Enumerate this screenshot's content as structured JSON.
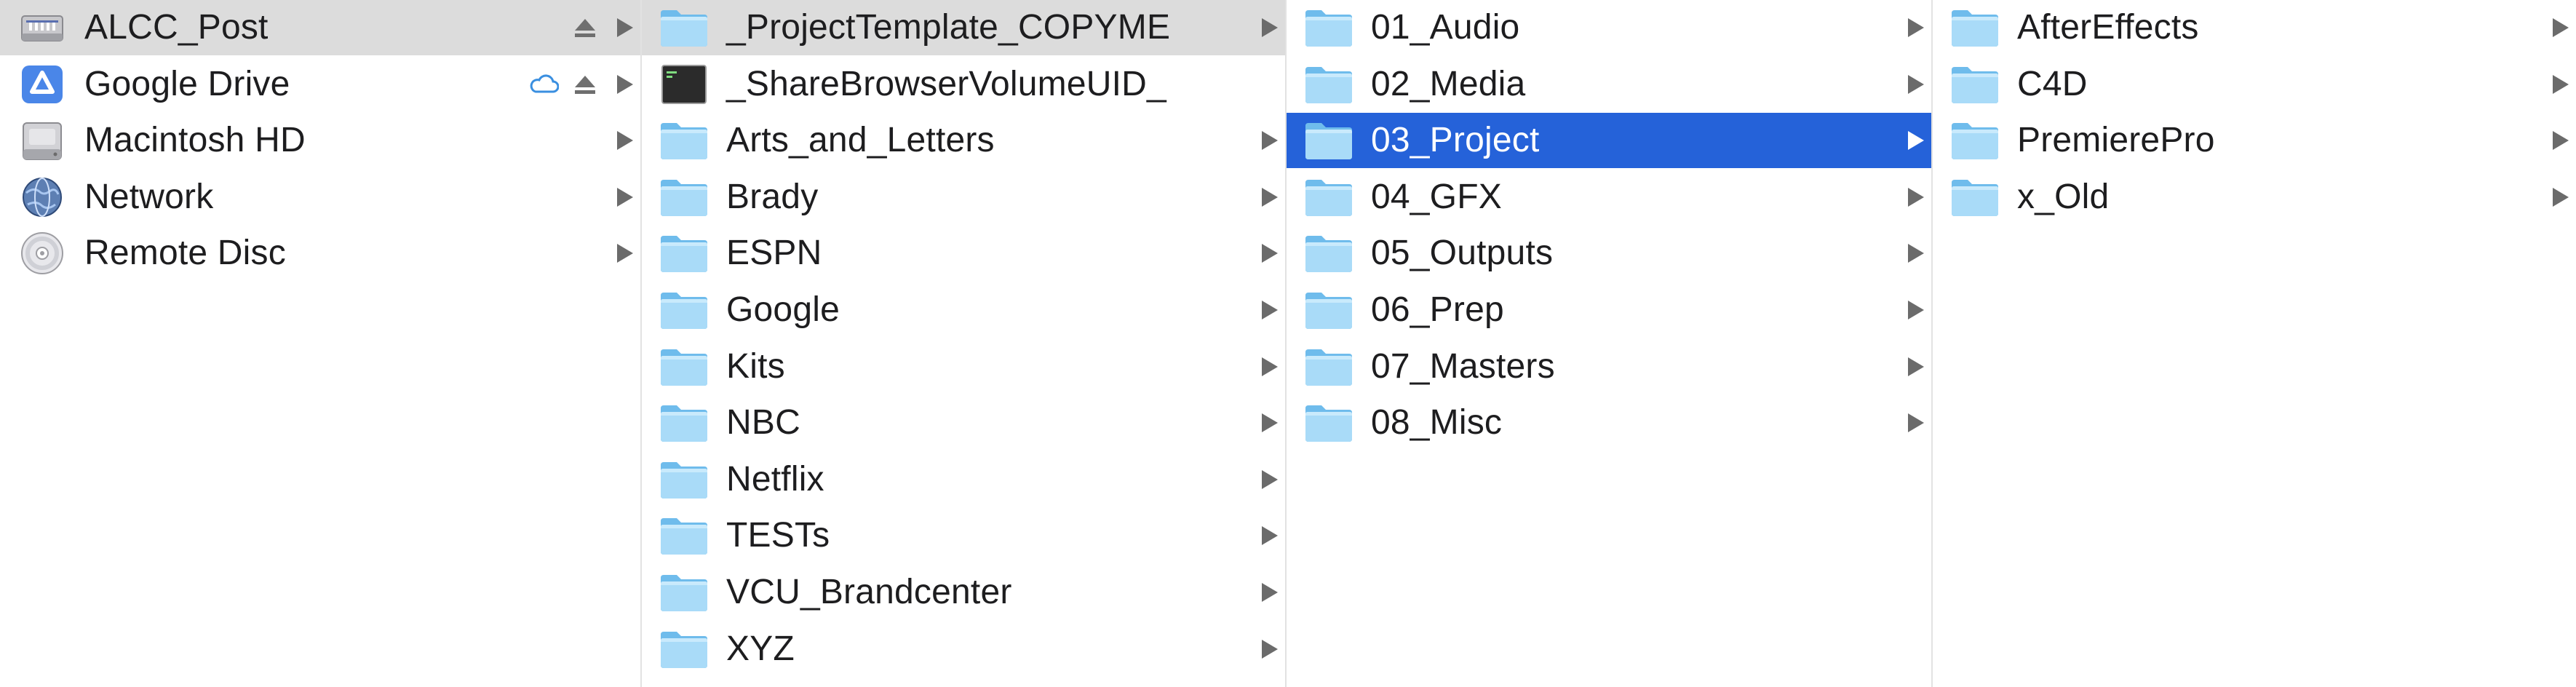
{
  "colors": {
    "selected_blue": "#2562d9",
    "selected_grey": "#dcdcdc",
    "folder_light": "#a9dbf8",
    "folder_dark": "#6fbcec",
    "arrow": "#6b6b6b"
  },
  "columns": [
    {
      "items": [
        {
          "label": "ALCC_Post",
          "icon": "server-drive-icon",
          "eject": true,
          "cloud": false,
          "selected": "grey"
        },
        {
          "label": "Google Drive",
          "icon": "google-drive-icon",
          "eject": true,
          "cloud": true,
          "selected": ""
        },
        {
          "label": "Macintosh HD",
          "icon": "hard-drive-icon",
          "eject": false,
          "cloud": false,
          "selected": ""
        },
        {
          "label": "Network",
          "icon": "network-globe-icon",
          "eject": false,
          "cloud": false,
          "selected": ""
        },
        {
          "label": "Remote Disc",
          "icon": "disc-icon",
          "eject": false,
          "cloud": false,
          "selected": ""
        }
      ]
    },
    {
      "items": [
        {
          "label": "_ProjectTemplate_COPYME",
          "icon": "folder-icon",
          "selected": "grey"
        },
        {
          "label": "_ShareBrowserVolumeUID_",
          "icon": "terminal-file-icon",
          "selected": "",
          "no_arrow": true
        },
        {
          "label": "Arts_and_Letters",
          "icon": "folder-icon",
          "selected": ""
        },
        {
          "label": "Brady",
          "icon": "folder-icon",
          "selected": ""
        },
        {
          "label": "ESPN",
          "icon": "folder-icon",
          "selected": ""
        },
        {
          "label": "Google",
          "icon": "folder-icon",
          "selected": ""
        },
        {
          "label": "Kits",
          "icon": "folder-icon",
          "selected": ""
        },
        {
          "label": "NBC",
          "icon": "folder-icon",
          "selected": ""
        },
        {
          "label": "Netflix",
          "icon": "folder-icon",
          "selected": ""
        },
        {
          "label": "TESTs",
          "icon": "folder-icon",
          "selected": ""
        },
        {
          "label": "VCU_Brandcenter",
          "icon": "folder-icon",
          "selected": ""
        },
        {
          "label": "XYZ",
          "icon": "folder-icon",
          "selected": ""
        }
      ]
    },
    {
      "items": [
        {
          "label": "01_Audio",
          "icon": "folder-icon",
          "selected": ""
        },
        {
          "label": "02_Media",
          "icon": "folder-icon",
          "selected": ""
        },
        {
          "label": "03_Project",
          "icon": "folder-icon",
          "selected": "blue"
        },
        {
          "label": "04_GFX",
          "icon": "folder-icon",
          "selected": ""
        },
        {
          "label": "05_Outputs",
          "icon": "folder-icon",
          "selected": ""
        },
        {
          "label": "06_Prep",
          "icon": "folder-icon",
          "selected": ""
        },
        {
          "label": "07_Masters",
          "icon": "folder-icon",
          "selected": ""
        },
        {
          "label": "08_Misc",
          "icon": "folder-icon",
          "selected": ""
        }
      ]
    },
    {
      "items": [
        {
          "label": "AfterEffects",
          "icon": "folder-icon",
          "selected": ""
        },
        {
          "label": "C4D",
          "icon": "folder-icon",
          "selected": ""
        },
        {
          "label": "PremierePro",
          "icon": "folder-icon",
          "selected": ""
        },
        {
          "label": "x_Old",
          "icon": "folder-icon",
          "selected": ""
        }
      ]
    }
  ]
}
